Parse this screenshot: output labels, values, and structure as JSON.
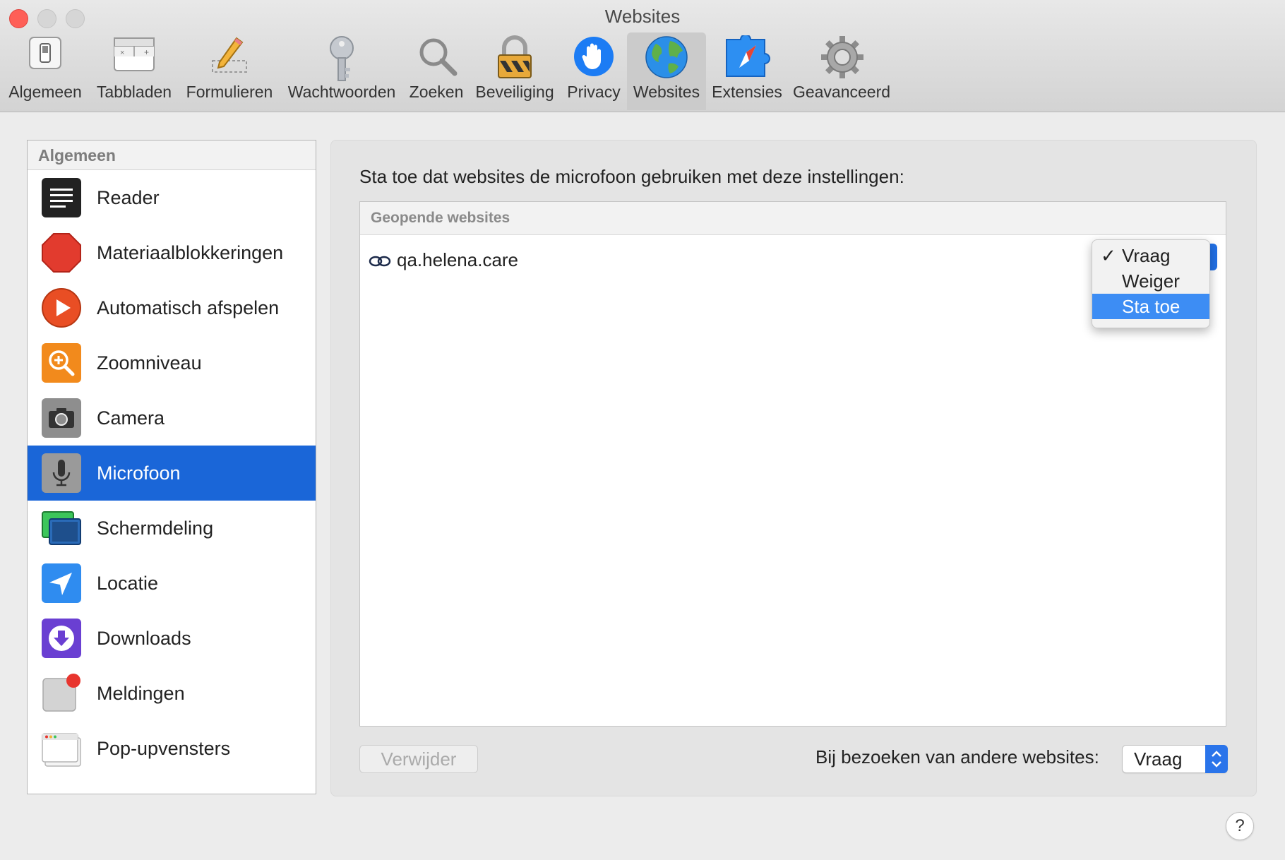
{
  "window": {
    "title": "Websites"
  },
  "toolbar": {
    "items": [
      {
        "label": "Algemeen",
        "icon": "general-switch-icon"
      },
      {
        "label": "Tabbladen",
        "icon": "tabs-icon"
      },
      {
        "label": "Formulieren",
        "icon": "pencil-form-icon"
      },
      {
        "label": "Wachtwoorden",
        "icon": "key-icon"
      },
      {
        "label": "Zoeken",
        "icon": "magnifier-icon"
      },
      {
        "label": "Beveiliging",
        "icon": "padlock-icon"
      },
      {
        "label": "Privacy",
        "icon": "hand-icon"
      },
      {
        "label": "Websites",
        "icon": "globe-icon"
      },
      {
        "label": "Extensies",
        "icon": "puzzle-compass-icon"
      },
      {
        "label": "Geavanceerd",
        "icon": "gear-icon"
      }
    ],
    "active": "Websites"
  },
  "sidebar": {
    "header": "Algemeen",
    "items": [
      {
        "label": "Reader",
        "icon": "reader-icon"
      },
      {
        "label": "Materiaalblokkeringen",
        "icon": "stop-octagon-icon"
      },
      {
        "label": "Automatisch afspelen",
        "icon": "play-icon"
      },
      {
        "label": "Zoomniveau",
        "icon": "zoom-icon"
      },
      {
        "label": "Camera",
        "icon": "camera-icon"
      },
      {
        "label": "Microfoon",
        "icon": "microphone-icon"
      },
      {
        "label": "Schermdeling",
        "icon": "screen-sharing-icon"
      },
      {
        "label": "Locatie",
        "icon": "location-arrow-icon"
      },
      {
        "label": "Downloads",
        "icon": "download-icon"
      },
      {
        "label": "Meldingen",
        "icon": "notification-icon"
      },
      {
        "label": "Pop-upvensters",
        "icon": "popup-window-icon"
      }
    ],
    "selected": "Microfoon"
  },
  "main": {
    "prompt": "Sta toe dat websites de microfoon gebruiken met deze instellingen:",
    "list_header": "Geopende websites",
    "sites": [
      {
        "domain": "qa.helena.care",
        "icon": "link-icon"
      }
    ],
    "menu": {
      "options": [
        {
          "label": "Vraag",
          "checked": true
        },
        {
          "label": "Weiger",
          "checked": false
        },
        {
          "label": "Sta toe",
          "checked": false,
          "highlighted": true
        }
      ],
      "check_mark": "✓"
    },
    "remove_button": "Verwijder",
    "other_label": "Bij bezoeken van andere websites:",
    "other_value": "Vraag"
  },
  "help": "?",
  "colors": {
    "accent": "#1a66d8",
    "highlight": "#3d8df4",
    "close": "#fe5f57"
  }
}
